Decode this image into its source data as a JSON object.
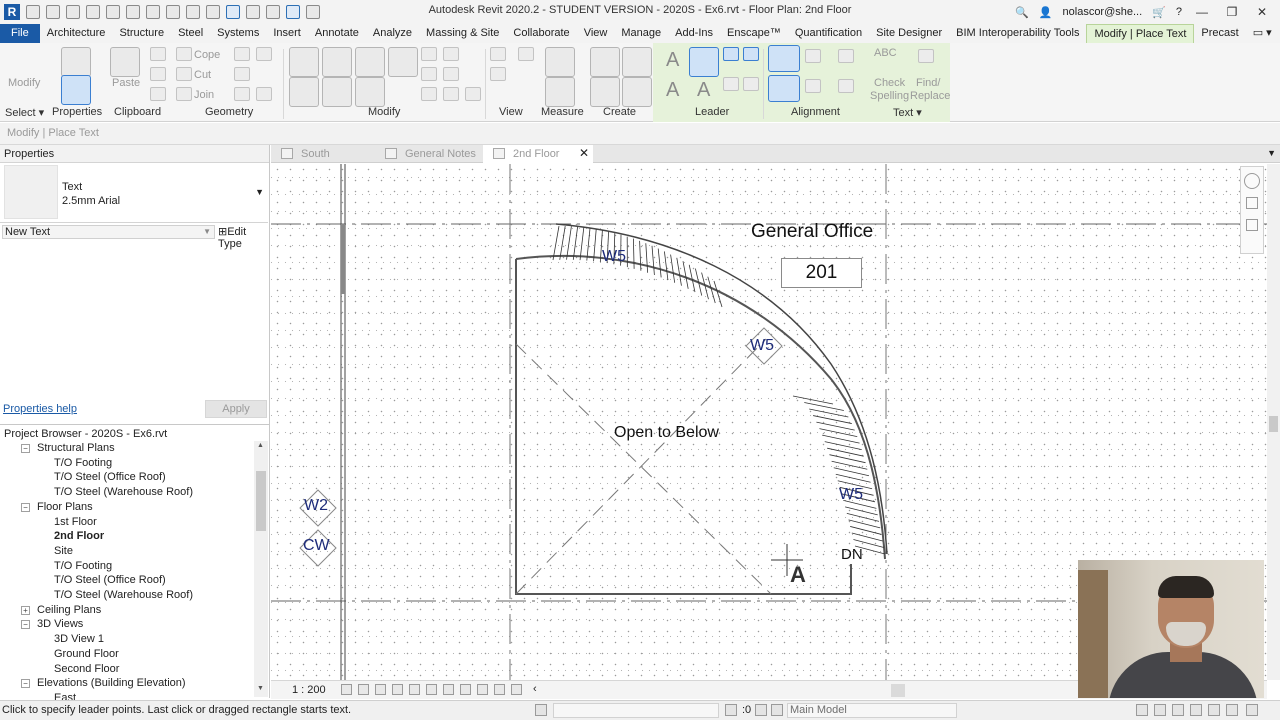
{
  "app": {
    "title": "Autodesk Revit 2020.2 - STUDENT VERSION - 2020S - Ex6.rvt - Floor Plan: 2nd Floor",
    "user": "nolascor@she..."
  },
  "ribbon_tabs": [
    "File",
    "Architecture",
    "Structure",
    "Steel",
    "Systems",
    "Insert",
    "Annotate",
    "Analyze",
    "Massing & Site",
    "Collaborate",
    "View",
    "Manage",
    "Add-Ins",
    "Enscape™",
    "Quantification",
    "Site Designer",
    "BIM Interoperability Tools",
    "Modify | Place Text",
    "Precast"
  ],
  "active_tab": "Modify | Place Text",
  "ribbon": {
    "modify_label": "Modify",
    "paste_label": "Paste",
    "cope_label": "Cope",
    "cut_label": "Cut",
    "join_label": "Join",
    "check_spelling_line1": "Check",
    "check_spelling_line2": "Spelling",
    "find_replace_line1": "Find/",
    "find_replace_line2": "Replace",
    "panels": {
      "select": "Select",
      "properties": "Properties",
      "clipboard": "Clipboard",
      "geometry": "Geometry",
      "modify": "Modify",
      "view": "View",
      "measure": "Measure",
      "create": "Create",
      "leader": "Leader",
      "alignment": "Alignment",
      "text": "Text"
    }
  },
  "options_bar": {
    "label": "Modify | Place Text"
  },
  "properties": {
    "header": "Properties",
    "type_name": "Text",
    "type_sub": "2.5mm Arial",
    "instance_selector": "New Text",
    "edit_type": "Edit Type",
    "help_link": "Properties help",
    "apply": "Apply"
  },
  "project_browser": {
    "header": "Project Browser - 2020S - Ex6.rvt",
    "items": [
      {
        "label": "Structural Plans",
        "bold": false
      },
      {
        "label": "T/O Footing",
        "bold": false
      },
      {
        "label": "T/O Steel (Office Roof)",
        "bold": false
      },
      {
        "label": "T/O Steel (Warehouse Roof)",
        "bold": false
      },
      {
        "label": "Floor Plans",
        "bold": false
      },
      {
        "label": "1st Floor",
        "bold": false
      },
      {
        "label": "2nd Floor",
        "bold": true
      },
      {
        "label": "Site",
        "bold": false
      },
      {
        "label": "T/O Footing",
        "bold": false
      },
      {
        "label": "T/O Steel (Office Roof)",
        "bold": false
      },
      {
        "label": "T/O Steel (Warehouse Roof)",
        "bold": false
      },
      {
        "label": "Ceiling Plans",
        "bold": false
      },
      {
        "label": "3D Views",
        "bold": false
      },
      {
        "label": "3D View 1",
        "bold": false
      },
      {
        "label": "Ground Floor",
        "bold": false
      },
      {
        "label": "Second Floor",
        "bold": false
      },
      {
        "label": "Elevations (Building Elevation)",
        "bold": false
      },
      {
        "label": "East",
        "bold": false
      }
    ]
  },
  "view_tabs": [
    {
      "label": "South",
      "active": false
    },
    {
      "label": "General Notes",
      "active": false
    },
    {
      "label": "2nd Floor",
      "active": true
    }
  ],
  "drawing": {
    "room_name": "General Office",
    "room_number": "201",
    "open_label": "Open to Below",
    "tag_w5": "W5",
    "tag_w2": "W2",
    "tag_cw": "CW",
    "dn_label": "DN",
    "cursor_letter": "A"
  },
  "view_control": {
    "scale": "1 : 200"
  },
  "status": {
    "message": "Click to specify leader points.  Last click or dragged rectangle starts text.",
    "zero": ":0",
    "model": "Main Model"
  },
  "colors": {
    "file_tab": "#1a5aa6",
    "context_tab": "#e4f3d6",
    "tag_text": "#1d2b7a"
  }
}
